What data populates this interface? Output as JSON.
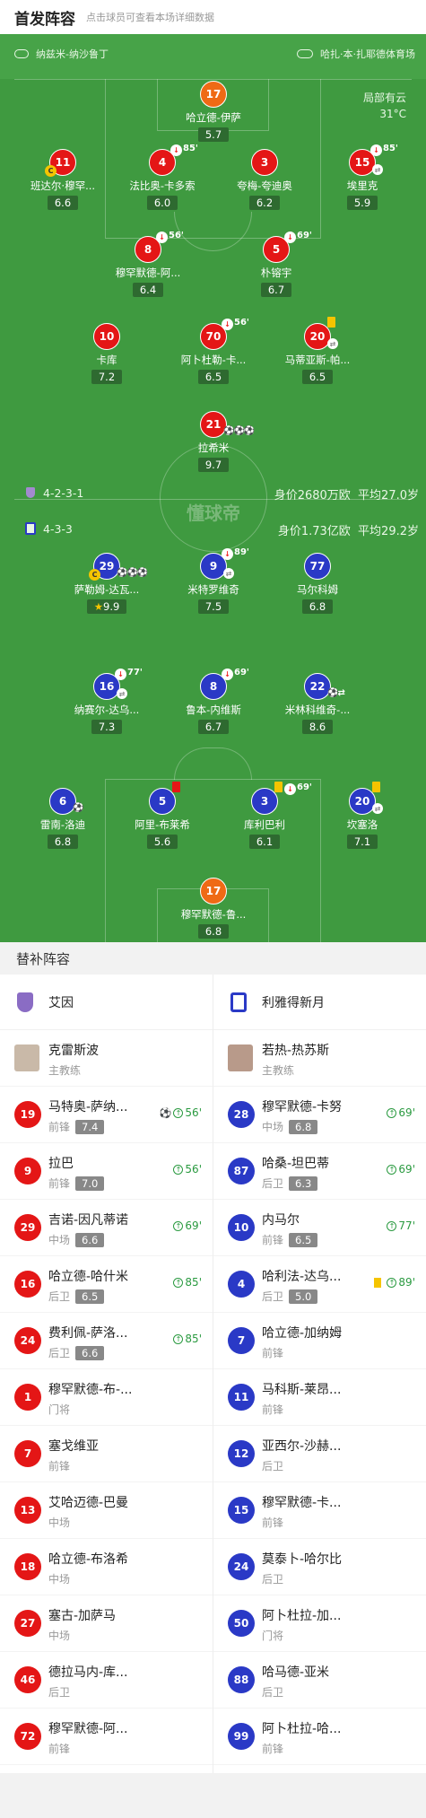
{
  "header": {
    "title": "首发阵容",
    "subtitle": "点击球员可查看本场详细数据"
  },
  "pitch": {
    "home_team": "纳兹米-纳沙鲁丁",
    "venue": "哈扎·本·扎耶德体育场",
    "weather": "局部有云",
    "temp": "31°C",
    "watermark": "懂球帝",
    "home_formation": "4-2-3-1",
    "home_value": "身价2680万欧",
    "home_avg_age": "平均27.0岁",
    "away_formation": "4-3-3",
    "away_value": "身价1.73亿欧",
    "away_avg_age": "平均29.2岁"
  },
  "home_players": [
    {
      "num": "17",
      "name": "哈立德-伊萨",
      "rating": "5.7"
    },
    {
      "num": "11",
      "name": "班达尔·穆罕...",
      "rating": "6.6"
    },
    {
      "num": "4",
      "name": "法比奥-卡多索",
      "rating": "6.0",
      "sub": "85'"
    },
    {
      "num": "3",
      "name": "夸梅-夸迪奥",
      "rating": "6.2"
    },
    {
      "num": "15",
      "name": "埃里克",
      "rating": "5.9",
      "sub": "85'"
    },
    {
      "num": "8",
      "name": "穆罕默德-阿...",
      "rating": "6.4",
      "sub": "56'"
    },
    {
      "num": "5",
      "name": "朴镕宇",
      "rating": "6.7",
      "sub": "69'"
    },
    {
      "num": "10",
      "name": "卡库",
      "rating": "7.2"
    },
    {
      "num": "70",
      "name": "阿卜杜勒-卡...",
      "rating": "6.5",
      "sub": "56'"
    },
    {
      "num": "20",
      "name": "马蒂亚斯-帕...",
      "rating": "6.5"
    },
    {
      "num": "21",
      "name": "拉希米",
      "rating": "9.7"
    }
  ],
  "away_players": [
    {
      "num": "29",
      "name": "萨勒姆-达瓦...",
      "rating": "9.9"
    },
    {
      "num": "9",
      "name": "米特罗维奇",
      "rating": "7.5",
      "sub": "89'"
    },
    {
      "num": "77",
      "name": "马尔科姆",
      "rating": "6.8"
    },
    {
      "num": "16",
      "name": "纳赛尔-达乌...",
      "rating": "7.3",
      "sub": "77'"
    },
    {
      "num": "8",
      "name": "鲁本-内维斯",
      "rating": "6.7",
      "sub": "69'"
    },
    {
      "num": "22",
      "name": "米林科维奇-...",
      "rating": "8.6"
    },
    {
      "num": "6",
      "name": "雷南-洛迪",
      "rating": "6.8"
    },
    {
      "num": "5",
      "name": "阿里-布莱希",
      "rating": "5.6"
    },
    {
      "num": "3",
      "name": "库利巴利",
      "rating": "6.1",
      "sub": "69'"
    },
    {
      "num": "20",
      "name": "坎塞洛",
      "rating": "7.1"
    },
    {
      "num": "17",
      "name": "穆罕默德-鲁...",
      "rating": "6.8"
    }
  ],
  "subs": {
    "title": "替补阵容",
    "home_team": "艾因",
    "away_team": "利雅得新月",
    "home_coach": {
      "name": "克雷斯波",
      "role": "主教练"
    },
    "away_coach": {
      "name": "若热-热苏斯",
      "role": "主教练"
    },
    "home": [
      {
        "num": "19",
        "name": "马特奥-萨纳...",
        "pos": "前锋",
        "score": "7.4",
        "time": "56'"
      },
      {
        "num": "9",
        "name": "拉巴",
        "pos": "前锋",
        "score": "7.0",
        "time": "56'"
      },
      {
        "num": "29",
        "name": "吉诺-因凡蒂诺",
        "pos": "中场",
        "score": "6.6",
        "time": "69'"
      },
      {
        "num": "16",
        "name": "哈立德-哈什米",
        "pos": "后卫",
        "score": "6.5",
        "time": "85'"
      },
      {
        "num": "24",
        "name": "费利佩-萨洛...",
        "pos": "后卫",
        "score": "6.6",
        "time": "85'"
      },
      {
        "num": "1",
        "name": "穆罕默德-布-...",
        "pos": "门将"
      },
      {
        "num": "7",
        "name": "塞戈维亚",
        "pos": "前锋"
      },
      {
        "num": "13",
        "name": "艾哈迈德-巴曼",
        "pos": "中场"
      },
      {
        "num": "18",
        "name": "哈立德-布洛希",
        "pos": "中场"
      },
      {
        "num": "27",
        "name": "塞古-加萨马",
        "pos": "中场"
      },
      {
        "num": "46",
        "name": "德拉马内-库...",
        "pos": "后卫"
      },
      {
        "num": "72",
        "name": "穆罕默德-阿...",
        "pos": "前锋"
      }
    ],
    "away": [
      {
        "num": "28",
        "name": "穆罕默德-卡努",
        "pos": "中场",
        "score": "6.8",
        "time": "69'"
      },
      {
        "num": "87",
        "name": "哈桑-坦巴蒂",
        "pos": "后卫",
        "score": "6.3",
        "time": "69'"
      },
      {
        "num": "10",
        "name": "内马尔",
        "pos": "前锋",
        "score": "6.5",
        "time": "77'"
      },
      {
        "num": "4",
        "name": "哈利法-达乌...",
        "pos": "后卫",
        "score": "5.0",
        "time": "89'"
      },
      {
        "num": "7",
        "name": "哈立德-加纳姆",
        "pos": "前锋"
      },
      {
        "num": "11",
        "name": "马科斯-莱昂...",
        "pos": "前锋"
      },
      {
        "num": "12",
        "name": "亚西尔-沙赫...",
        "pos": "后卫"
      },
      {
        "num": "15",
        "name": "穆罕默德-卡...",
        "pos": "前锋"
      },
      {
        "num": "24",
        "name": "莫泰卜-哈尔比",
        "pos": "后卫"
      },
      {
        "num": "50",
        "name": "阿卜杜拉-加...",
        "pos": "门将"
      },
      {
        "num": "88",
        "name": "哈马德-亚米",
        "pos": "后卫"
      },
      {
        "num": "99",
        "name": "阿卜杜拉-哈...",
        "pos": "前锋"
      }
    ]
  }
}
